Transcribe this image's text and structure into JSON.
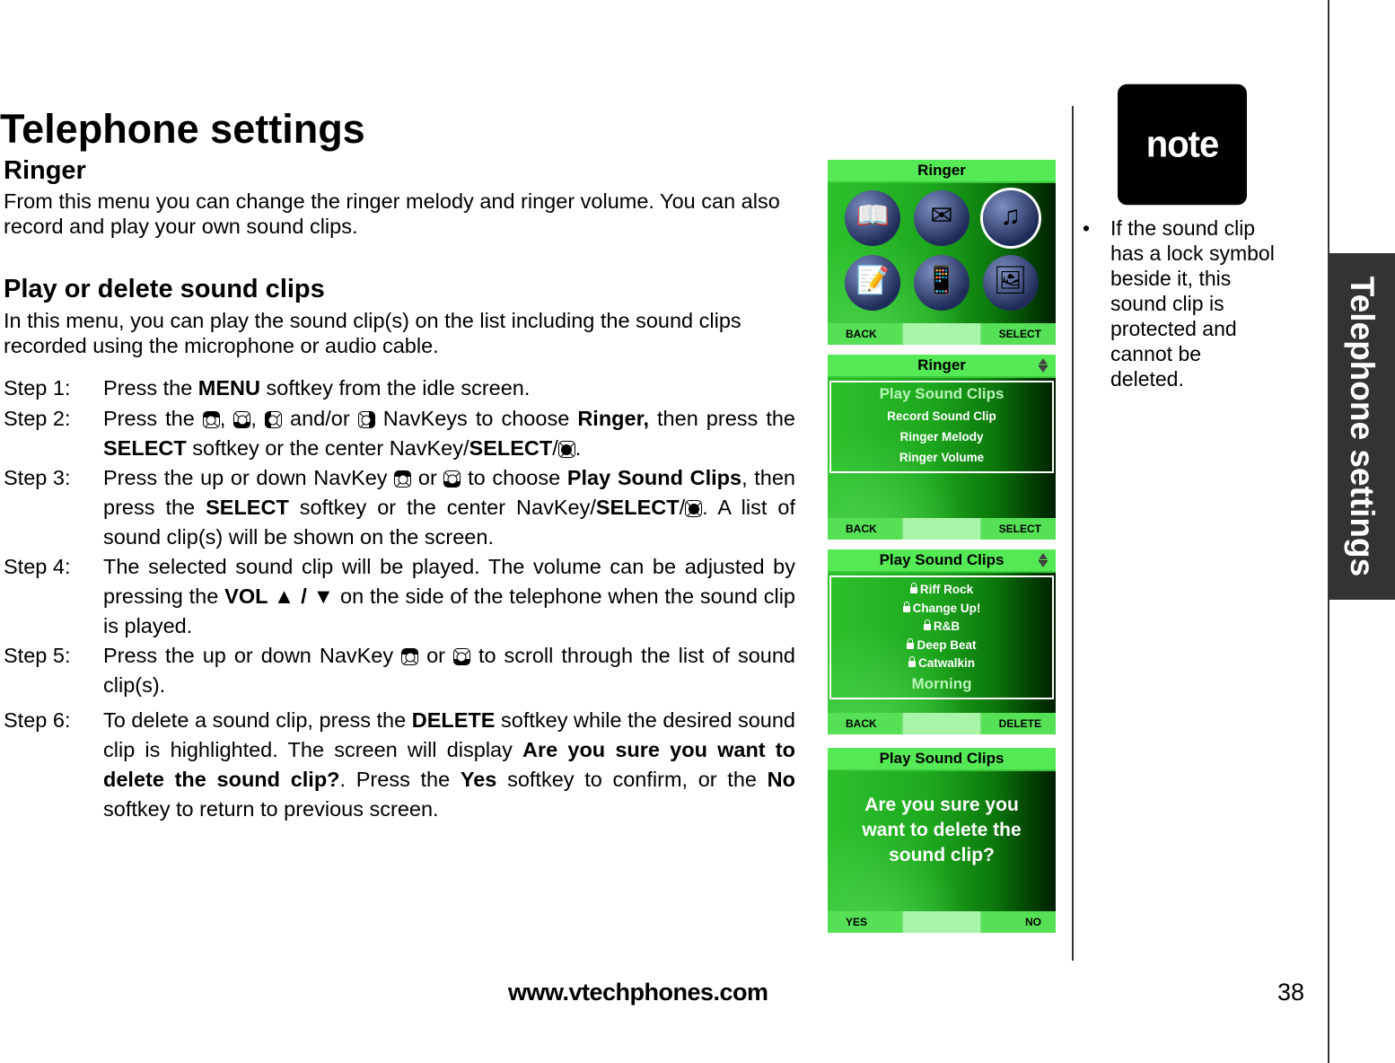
{
  "page": {
    "title": "Telephone settings",
    "side_tab": "Telephone settings",
    "footer_url": "www.vtechphones.com",
    "page_number": "38"
  },
  "ringer": {
    "heading": "Ringer",
    "intro": "From this menu you can change the ringer melody and ringer volume. You can also record and play your own sound clips."
  },
  "play_delete": {
    "heading": "Play or delete sound clips",
    "intro": "In this menu, you can play the sound clip(s) on the list including the sound clips recorded using the microphone or audio cable.",
    "steps": [
      {
        "label": "Step 1:",
        "parts": [
          "Press the ",
          {
            "b": "MENU"
          },
          " softkey from the idle screen."
        ]
      },
      {
        "label": "Step 2:",
        "parts": [
          "Press the ",
          {
            "nav": "up"
          },
          ", ",
          {
            "nav": "down"
          },
          ", ",
          {
            "nav": "left"
          },
          " and/or ",
          {
            "nav": "right"
          },
          " NavKeys to choose ",
          {
            "b": "Ringer,"
          },
          " then press the ",
          {
            "b": "SELECT"
          },
          " softkey or the center NavKey/",
          {
            "b": "SELECT"
          },
          "/",
          {
            "nav": "center"
          },
          "."
        ]
      },
      {
        "label": "Step 3:",
        "parts": [
          "Press the up or down NavKey ",
          {
            "nav": "up"
          },
          " or ",
          {
            "nav": "down"
          },
          " to choose ",
          {
            "b": "Play Sound Clips"
          },
          ", then press the ",
          {
            "b": "SELECT"
          },
          " softkey or the center NavKey/",
          {
            "b": "SELECT"
          },
          "/",
          {
            "nav": "center"
          },
          ". A list of sound clip(s) will be shown on the screen."
        ]
      },
      {
        "label": "Step 4:",
        "parts": [
          "The selected sound clip will be played. The volume can be adjusted by pressing the ",
          {
            "b": "VOL ▲ / ▼"
          },
          " on the side of the telephone when the sound clip is played."
        ]
      },
      {
        "label": "Step 5:",
        "parts": [
          "Press the up or down NavKey ",
          {
            "nav": "up"
          },
          " or ",
          {
            "nav": "down"
          },
          " to scroll through the list of sound clip(s)."
        ]
      },
      {
        "label": "Step 6:",
        "parts": [
          "To delete a sound clip, press the ",
          {
            "b": "DELETE"
          },
          " softkey while the desired sound clip is highlighted. The screen will display ",
          {
            "b": "Are you sure you want to delete the sound clip?"
          },
          ". Press the ",
          {
            "b": "Yes"
          },
          " softkey to confirm, or the ",
          {
            "b": "No"
          },
          " softkey to return to previous screen."
        ]
      }
    ]
  },
  "screens": {
    "s1": {
      "title": "Ringer",
      "icons": [
        "directory-icon",
        "messages-icon",
        "ringer-icon",
        "notes-icon",
        "phone-settings-icon",
        "pictures-icon"
      ],
      "icon_glyphs": [
        "📖",
        "✉",
        "♫",
        "📝",
        "📱",
        "🖼"
      ],
      "selected_icon": 2,
      "left_softkey": "BACK",
      "right_softkey": "SELECT"
    },
    "s2": {
      "title": "Ringer",
      "items": [
        "Play Sound Clips",
        "Record Sound Clip",
        "Ringer Melody",
        "Ringer Volume"
      ],
      "highlighted": 0,
      "left_softkey": "BACK",
      "right_softkey": "SELECT"
    },
    "s3": {
      "title": "Play Sound Clips",
      "items": [
        {
          "name": "Riff Rock",
          "locked": true
        },
        {
          "name": "Change Up!",
          "locked": true
        },
        {
          "name": "R&B",
          "locked": true
        },
        {
          "name": "Deep Beat",
          "locked": true
        },
        {
          "name": "Catwalkin",
          "locked": true
        },
        {
          "name": "Morning",
          "locked": false
        }
      ],
      "highlighted": 5,
      "left_softkey": "BACK",
      "right_softkey": "DELETE"
    },
    "s4": {
      "title": "Play Sound Clips",
      "message": "Are you sure you want to delete the sound clip?",
      "left_softkey": "YES",
      "right_softkey": "NO"
    }
  },
  "note": {
    "badge": "note",
    "bullet": "•",
    "text": "If the sound clip has a lock symbol beside it, this sound clip is protected and cannot be deleted."
  },
  "colors": {
    "screen_header": "#55ea55",
    "side_tab": "#333333"
  }
}
